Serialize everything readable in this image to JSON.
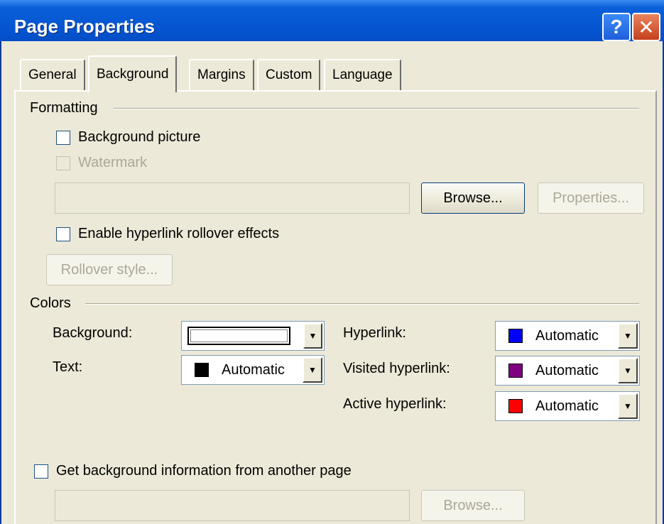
{
  "window": {
    "title": "Page Properties",
    "help_glyph": "?",
    "close_glyph": "✕"
  },
  "tabs": [
    {
      "label": "General",
      "active": false
    },
    {
      "label": "Background",
      "active": true
    },
    {
      "label": "Margins",
      "active": false
    },
    {
      "label": "Custom",
      "active": false
    },
    {
      "label": "Language",
      "active": false
    }
  ],
  "formatting": {
    "group_label": "Formatting",
    "background_picture": {
      "label": "Background picture",
      "checked": false,
      "enabled": true
    },
    "watermark": {
      "label": "Watermark",
      "checked": false,
      "enabled": false
    },
    "picture_path": "",
    "browse_label": "Browse...",
    "properties_label": "Properties...",
    "rollover": {
      "label": "Enable hyperlink rollover effects",
      "checked": false,
      "enabled": true
    },
    "rollover_style_label": "Rollover style..."
  },
  "colors": {
    "group_label": "Colors",
    "background": {
      "label": "Background:",
      "value": "",
      "swatch": "#ffffff"
    },
    "text": {
      "label": "Text:",
      "value": "Automatic",
      "swatch": "#000000"
    },
    "hyperlink": {
      "label": "Hyperlink:",
      "value": "Automatic",
      "swatch": "#0000ff"
    },
    "visited": {
      "label": "Visited hyperlink:",
      "value": "Automatic",
      "swatch": "#800080"
    },
    "active": {
      "label": "Active hyperlink:",
      "value": "Automatic",
      "swatch": "#ff0000"
    }
  },
  "other_page": {
    "label": "Get background information from another page",
    "checked": false,
    "path": "",
    "browse_label": "Browse..."
  }
}
